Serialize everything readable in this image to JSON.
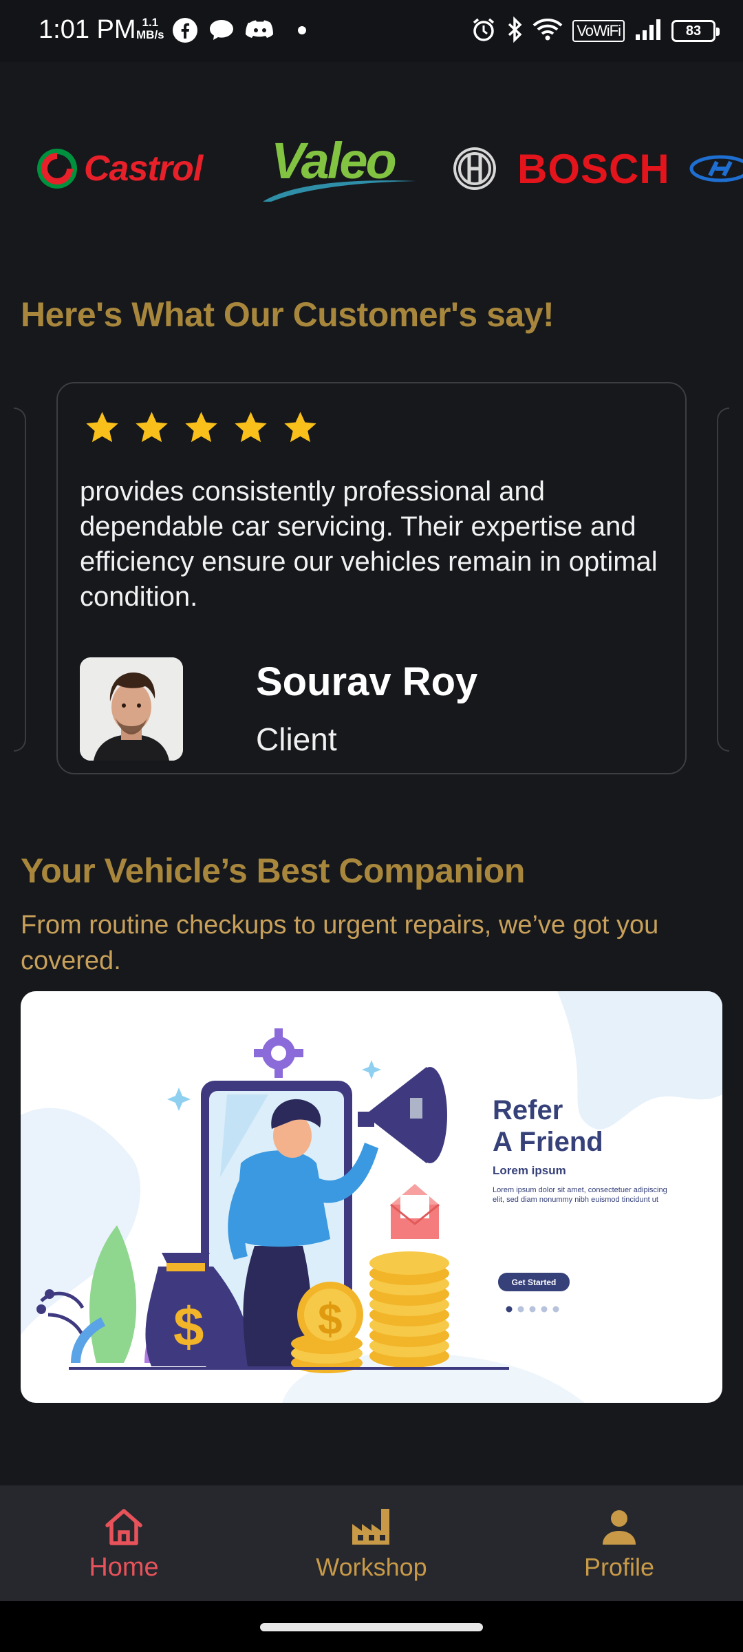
{
  "status_bar": {
    "time": "1:01 PM",
    "speed_value": "1.1",
    "speed_unit": "MB/s",
    "network_label": "VoWiFi",
    "battery": "83",
    "icons": [
      "facebook-icon",
      "chat-icon",
      "discord-icon",
      "dot-icon",
      "alarm-icon",
      "bluetooth-icon",
      "wifi-icon",
      "signal-icon",
      "battery-icon"
    ]
  },
  "brands": {
    "items": [
      "Castrol",
      "Valeo",
      "BOSCH"
    ]
  },
  "testimonials": {
    "heading": "Here's What Our Customer's say!",
    "rating": 5,
    "quote": "provides consistently professional and dependable car servicing. Their expertise and efficiency ensure our vehicles remain in optimal condition.",
    "name": "Sourav Roy",
    "role": "Client"
  },
  "companion": {
    "heading": "Your Vehicle’s Best Companion",
    "subtitle": "From routine checkups to urgent repairs, we’ve got you covered.",
    "banner": {
      "title_line1": "Refer",
      "title_line2": "A Friend",
      "subtitle": "Lorem ipsum",
      "body_line1": "Lorem ipsum dolor sit amet, consectetuer adipiscing",
      "body_line2": "elit, sed diam nonummy nibh euismod tincidunt ut",
      "button": "Get Started"
    }
  },
  "bottom_nav": {
    "items": [
      {
        "label": "Home",
        "icon": "home-icon",
        "active": true
      },
      {
        "label": "Workshop",
        "icon": "factory-icon",
        "active": false
      },
      {
        "label": "Profile",
        "icon": "person-icon",
        "active": false
      }
    ],
    "active_color": "#e8525a",
    "inactive_color": "#c89a48"
  },
  "colors": {
    "background": "#16181c",
    "heading_gold": "#a8873d",
    "star": "#f9bf1a"
  }
}
